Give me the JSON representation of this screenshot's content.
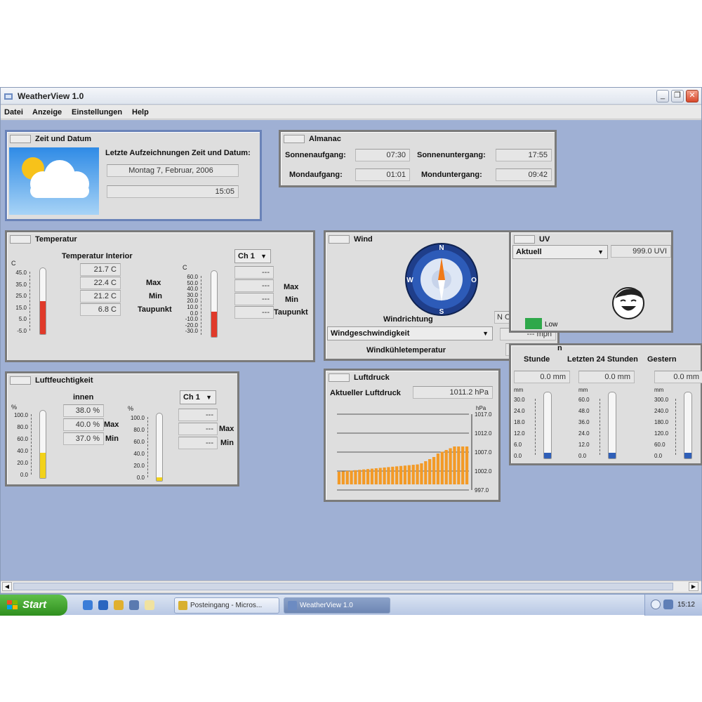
{
  "window": {
    "title": "WeatherView 1.0"
  },
  "menu": {
    "datei": "Datei",
    "anzeige": "Anzeige",
    "einstellungen": "Einstellungen",
    "hilfe": "Help"
  },
  "zeit": {
    "title": "Zeit und Datum",
    "heading": "Letzte Aufzeichnungen Zeit und Datum:",
    "date": "Montag  7, Februar, 2006",
    "time": "15:05"
  },
  "almanac": {
    "title": "Almanac",
    "sunrise_label": "Sonnenaufgang:",
    "sunrise": "07:30",
    "sunset_label": "Sonnenuntergang:",
    "sunset": "17:55",
    "moonrise_label": "Mondaufgang:",
    "moonrise": "01:01",
    "moonset_label": "Monduntergang:",
    "moonset": "09:42"
  },
  "temperatur": {
    "title": "Temperatur",
    "interior_label": "Temperatur Interior",
    "unit": "C",
    "values": [
      "21.7 C",
      "22.4 C",
      "21.2 C",
      "6.8 C"
    ],
    "max_label": "Max",
    "min_label": "Min",
    "taupunkt_label": "Taupunkt",
    "channel": "Ch 1",
    "ch_values": [
      "---",
      "---",
      "---",
      "---"
    ],
    "scale_left": [
      "45.0",
      "35.0",
      "25.0",
      "15.0",
      "5.0",
      "-5.0"
    ],
    "scale_right": [
      "60.0",
      "50.0",
      "40.0",
      "30.0",
      "20.0",
      "10.0",
      "0.0",
      "-10.0",
      "-20.0",
      "-30.0"
    ],
    "fill_inner": 0.5,
    "fill_channel": 0.38
  },
  "wind": {
    "title": "Wind",
    "direction_label": "Windrichtung",
    "direction_value": "N O",
    "compass": [
      "N",
      "O",
      "S",
      "W"
    ],
    "speed_label": "Windgeschwindigkeit",
    "speed_value": "--- mph",
    "chill_label": "Windkühletemperatur",
    "chill_value": "---"
  },
  "uv": {
    "title": "UV",
    "mode": "Aktuell",
    "value": "999.0 UVI",
    "level": "Low"
  },
  "luftfeuchtigkeit": {
    "title": "Luftfeuchtigkeit",
    "innen_label": "innen",
    "unit": "%",
    "values": [
      "38.0 %",
      "40.0 %",
      "37.0 %"
    ],
    "max_label": "Max",
    "min_label": "Min",
    "channel": "Ch 1",
    "ch_values": [
      "---",
      "---",
      "---"
    ],
    "scale": [
      "100.0",
      "80.0",
      "60.0",
      "40.0",
      "20.0",
      "0.0"
    ],
    "fill_inner": 0.38,
    "fill_channel": 0.05
  },
  "luftdruck": {
    "title": "Luftdruck",
    "current_label": "Aktueller Luftdruck",
    "current_value": "1011.2 hPa",
    "unit": "hPa",
    "scale": [
      "1017.0",
      "1012.0",
      "1007.0",
      "1002.0",
      "997.0"
    ]
  },
  "regen": {
    "title_visible": "n",
    "col_labels": [
      "Stunde",
      "Letzten  24 Stunden",
      "Gestern"
    ],
    "values": [
      "0.0 mm",
      "0.0 mm",
      "0.0 mm"
    ],
    "unit": "mm",
    "scales": [
      [
        "30.0",
        "24.0",
        "18.0",
        "12.0",
        "6.0",
        "0.0"
      ],
      [
        "60.0",
        "48.0",
        "36.0",
        "24.0",
        "12.0",
        "0.0"
      ],
      [
        "300.0",
        "240.0",
        "180.0",
        "120.0",
        "60.0",
        "0.0"
      ]
    ]
  },
  "taskbar": {
    "start": "Start",
    "tasks": [
      "Posteingang - Micros...",
      "WeatherView 1.0"
    ],
    "clock": "15:12"
  },
  "colors": {
    "desk": "#9fb0d4",
    "thermo_fill": "#e03a2a",
    "humid_fill": "#f2d21a",
    "uv_green": "#2ea84a",
    "pressure_bar": "#f39a26"
  }
}
